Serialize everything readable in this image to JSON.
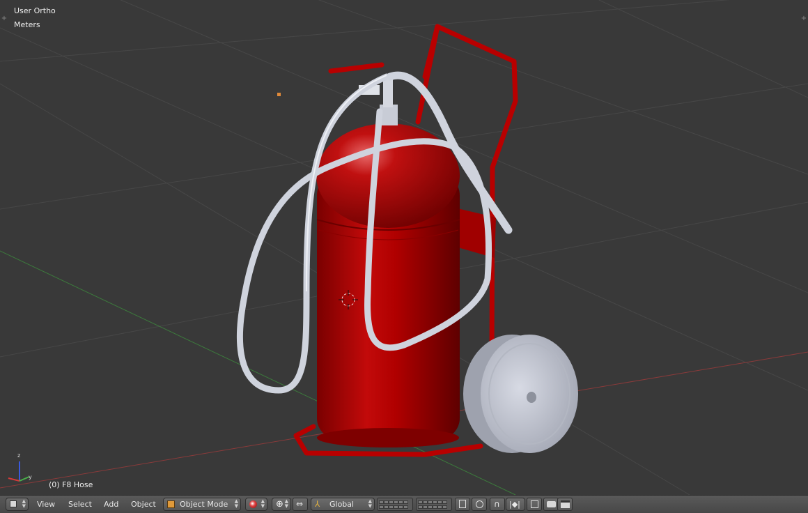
{
  "viewport": {
    "view_name": "User Ortho",
    "units": "Meters",
    "object_info": "(0) F8 Hose"
  },
  "header": {
    "menus": [
      "View",
      "Select",
      "Add",
      "Object"
    ],
    "mode": "Object Mode",
    "pivot": "Global"
  },
  "colors": {
    "background": "#393939",
    "extinguisher_red": "#b00000",
    "grid_line": "#474747",
    "x_axis": "#8a3a3a",
    "y_axis": "#3c7a3c",
    "hose": "#cfd3dd",
    "wheel": "#c6c9d4"
  },
  "icons": {
    "editor_type": "cube-icon",
    "mode": "object-mode-cube-icon",
    "shading": "shading-sphere-icon",
    "pivot": "pivot-point-icon",
    "manipulator": "transform-manipulator-icon",
    "orientation": "transform-orientation-icon",
    "render": "camera-icon"
  }
}
